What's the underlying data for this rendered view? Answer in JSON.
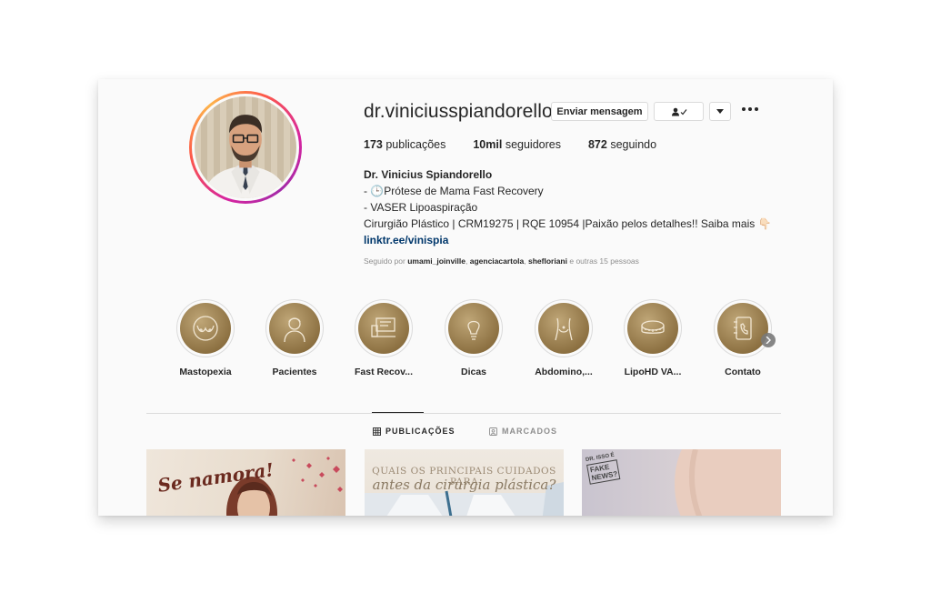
{
  "profile": {
    "username": "dr.viniciusspiandorello",
    "message_button": "Enviar mensagem",
    "stats": [
      {
        "count": "173",
        "label": "publicações"
      },
      {
        "count": "10mil",
        "label": "seguidores"
      },
      {
        "count": "872",
        "label": "seguindo"
      }
    ],
    "bio": {
      "name": "Dr. Vinicius Spiandorello",
      "lines": [
        "- 🕒Prótese de Mama Fast Recovery",
        "- VASER Lipoaspiração",
        "Cirurgião Plástico | CRM19275 | RQE 10954 |Paixão pelos detalhes!! Saiba mais 👇🏻"
      ],
      "link": "linktr.ee/vinispia"
    },
    "followed_by": {
      "prefix": "Seguido por",
      "users": [
        "umami_joinville",
        "agenciacartola",
        "shefloriani"
      ],
      "suffix": "e outras 15 pessoas"
    }
  },
  "highlights": [
    {
      "label": "Mastopexia",
      "icon": "breast-icon"
    },
    {
      "label": "Pacientes",
      "icon": "person-icon"
    },
    {
      "label": "Fast Recov...",
      "icon": "computer-icon"
    },
    {
      "label": "Dicas",
      "icon": "lightbulb-icon"
    },
    {
      "label": "Abdomino,...",
      "icon": "abdomen-icon"
    },
    {
      "label": "LipoHD VA...",
      "icon": "tape-measure-icon"
    },
    {
      "label": "Contato",
      "icon": "contact-book-icon"
    }
  ],
  "tabs": {
    "posts": "PUBLICAÇÕES",
    "tagged": "MARCADOS"
  },
  "posts": [
    {
      "text": "Se namora!"
    },
    {
      "title": "QUAIS OS PRINCIPAIS CUIDADOS PARA",
      "subtitle": "antes da cirurgia plástica?"
    },
    {
      "stamp_top": "DR. ISSO É",
      "stamp_box": "FAKE NEWS?"
    }
  ],
  "colors": {
    "link": "#00376b",
    "text": "#262626",
    "muted": "#8e8e8e",
    "highlight_gold": "#8a6e3f"
  }
}
